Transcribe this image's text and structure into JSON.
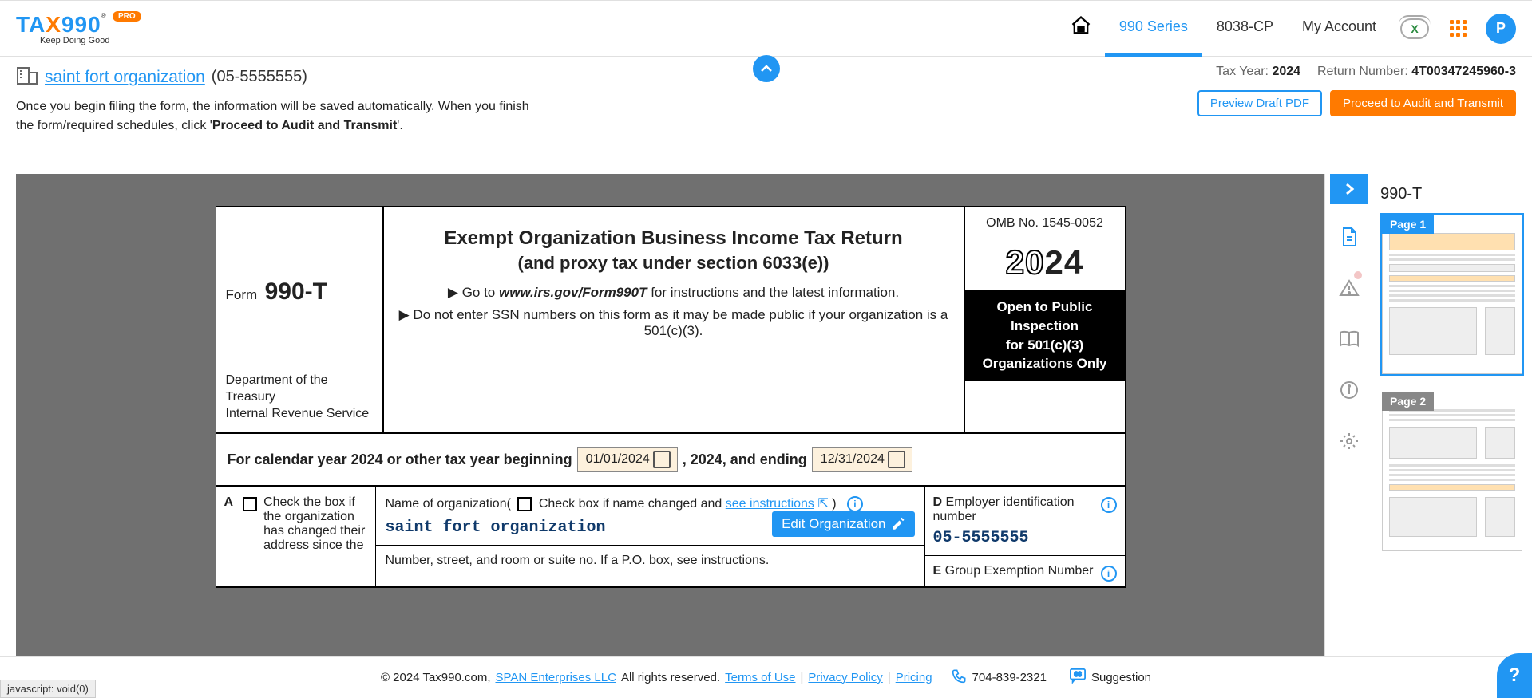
{
  "header": {
    "logo_prefix": "TA",
    "logo_x": "X",
    "logo_suffix": "990",
    "reg": "®",
    "pro": "PRO",
    "tagline": "Keep Doing Good",
    "nav": {
      "series": "990 Series",
      "8038": "8038-CP",
      "account": "My Account"
    },
    "avatar": "P"
  },
  "sub": {
    "org_name": "saint fort organization",
    "org_ein_inline": "(05-5555555)",
    "desc_pre": "Once you begin filing the form, the information will be saved automatically. When you finish the form/required schedules, click '",
    "desc_bold": "Proceed to Audit and Transmit",
    "desc_post": "'.",
    "tax_year_lbl": "Tax Year: ",
    "tax_year": "2024",
    "return_lbl": "Return Number: ",
    "return_num": "4T00347245960-3",
    "preview_btn": "Preview Draft PDF",
    "proceed_btn": "Proceed to Audit and Transmit"
  },
  "form": {
    "form_word": "Form",
    "form_num": "990-T",
    "dept1": "Department of the Treasury",
    "dept2": "Internal Revenue Service",
    "title1": "Exempt Organization Business Income Tax Return",
    "title2": "(and proxy tax under section 6033(e))",
    "instr1_pre": "▶ Go to ",
    "instr1_i": "www.irs.gov/Form990T",
    "instr1_post": " for instructions and the latest information.",
    "instr2": "▶ Do not enter SSN numbers on this form as it may be made public if your organization is a 501(c)(3).",
    "omb": "OMB No. 1545-0052",
    "year_outline": "20",
    "year_solid": "24",
    "black1": "Open to Public Inspection",
    "black2": "for 501(c)(3) Organizations Only",
    "cal_pre": "For calendar year 2024 or other tax year beginning",
    "date1": "01/01/2024",
    "cal_mid": ", 2024, and ending",
    "date2": "12/31/2024",
    "A_lbl": "A",
    "A_text": "Check the box if the organization has changed their address since the",
    "name_pre": "Name of organization(",
    "name_mid": "Check box if name changed and ",
    "see_instr": "see instructions",
    "name_post": " )",
    "org_name_val": "saint fort organization",
    "edit_btn": "Edit Organization",
    "addr_line": "Number, street, and room or suite no. If a P.O. box, see instructions.",
    "D_lbl": "D",
    "D_text": "Employer identification number",
    "D_val": "05-5555555",
    "E_lbl": "E",
    "E_text": "Group Exemption Number"
  },
  "thumbs": {
    "title": "990-T",
    "p1": "Page 1",
    "p2": "Page 2"
  },
  "footer": {
    "copyright": "© 2024 Tax990.com, ",
    "span_link": "SPAN Enterprises LLC",
    "rights": " All rights reserved. ",
    "terms": "Terms of Use",
    "privacy": "Privacy Policy",
    "pricing": "Pricing",
    "phone": "704-839-2321",
    "suggestion": "Suggestion"
  },
  "status": "javascript: void(0)"
}
